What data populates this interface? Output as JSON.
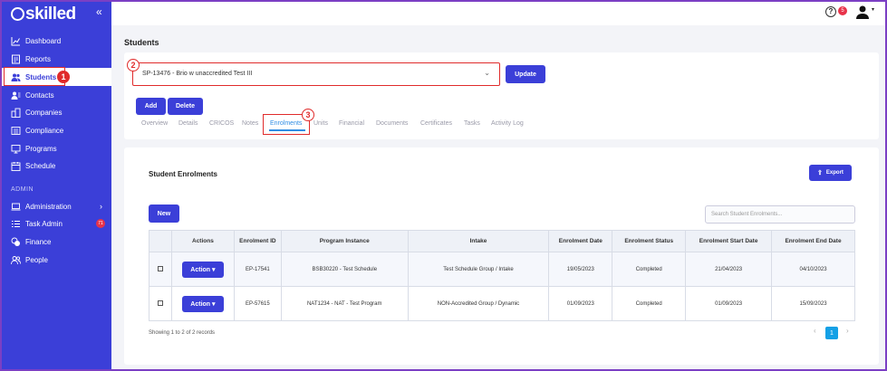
{
  "app": {
    "logo_text": "skilled",
    "brand_color": "#3b3fd8",
    "collapse_icon": "«"
  },
  "sidebar": {
    "items": [
      {
        "label": "Dashboard"
      },
      {
        "label": "Reports"
      },
      {
        "label": "Students"
      },
      {
        "label": "Contacts"
      },
      {
        "label": "Companies"
      },
      {
        "label": "Compliance"
      },
      {
        "label": "Programs"
      },
      {
        "label": "Schedule"
      }
    ],
    "section_label": "ADMIN",
    "admin_items": [
      {
        "label": "Administration"
      },
      {
        "label": "Task Admin",
        "badge": "71"
      },
      {
        "label": "Finance"
      },
      {
        "label": "People"
      }
    ]
  },
  "topbar": {
    "help_glyph": "?",
    "notification_count": "5",
    "user_caret": "▾"
  },
  "page": {
    "title": "Students"
  },
  "student_select": {
    "value": "SP-13476 - Brio w unaccredited Test III",
    "chevron": "⌄"
  },
  "buttons": {
    "update": "Update",
    "add": "Add",
    "delete": "Delete",
    "export": "Export",
    "new": "New"
  },
  "tabs": [
    {
      "label": "Overview"
    },
    {
      "label": "Details"
    },
    {
      "label": "CRICOS"
    },
    {
      "label": "Notes"
    },
    {
      "label": "Enrolments"
    },
    {
      "label": "Units"
    },
    {
      "label": "Financial"
    },
    {
      "label": "Documents"
    },
    {
      "label": "Certificates"
    },
    {
      "label": "Tasks"
    },
    {
      "label": "Activity Log"
    }
  ],
  "markers": {
    "m1": "1",
    "m2": "2",
    "m3": "3"
  },
  "enrolments": {
    "title": "Student Enrolments",
    "search_placeholder": "Search Student Enrolments...",
    "columns": [
      "Actions",
      "Enrolment ID",
      "Program Instance",
      "Intake",
      "Enrolment Date",
      "Enrolment Status",
      "Enrolment Start Date",
      "Enrolment End Date"
    ],
    "action_label": "Action ▾",
    "rows": [
      {
        "id": "EP-17541",
        "program": "BSB30220 - Test Schedule",
        "intake": "Test Schedule Group / Intake",
        "date": "19/05/2023",
        "status": "Completed",
        "start": "21/04/2023",
        "end": "04/10/2023"
      },
      {
        "id": "EP-57615",
        "program": "NAT1234 - NAT - Test Program",
        "intake": "NON-Accredited Group / Dynamic",
        "date": "01/09/2023",
        "status": "Completed",
        "start": "01/09/2023",
        "end": "15/09/2023"
      }
    ],
    "showing": "Showing 1 to 2 of 2 records",
    "pager": {
      "prev": "‹",
      "current": "1",
      "next": "›"
    }
  }
}
